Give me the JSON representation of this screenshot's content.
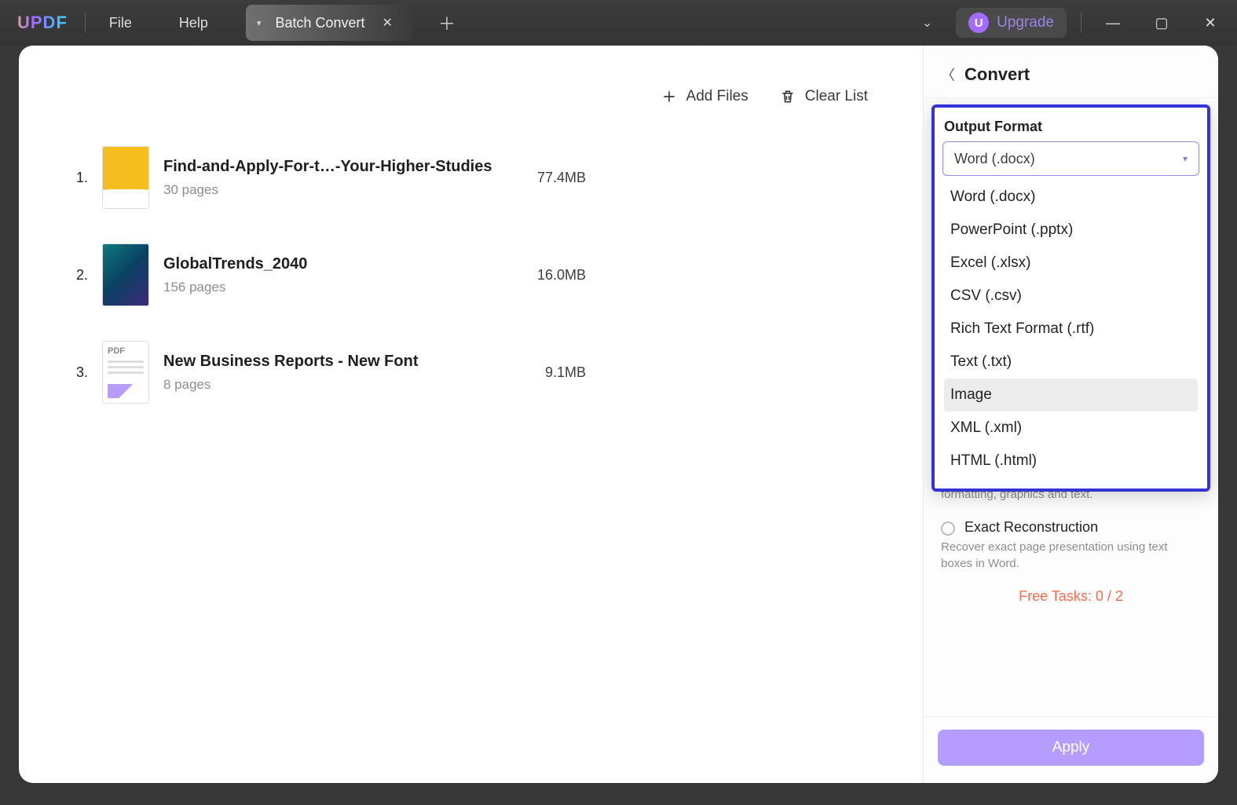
{
  "titlebar": {
    "logo": "UPDF",
    "menu_file": "File",
    "menu_help": "Help",
    "tab_label": "Batch Convert",
    "upgrade_letter": "U",
    "upgrade_label": "Upgrade"
  },
  "actions": {
    "add_files": "Add Files",
    "clear_list": "Clear List"
  },
  "files": [
    {
      "num": "1.",
      "name": "Find-and-Apply-For-t…-Your-Higher-Studies",
      "pages": "30 pages",
      "size": "77.4MB",
      "thumb": "t1"
    },
    {
      "num": "2.",
      "name": "GlobalTrends_2040",
      "pages": "156 pages",
      "size": "16.0MB",
      "thumb": "t2"
    },
    {
      "num": "3.",
      "name": "New Business Reports - New Font",
      "pages": "8 pages",
      "size": "9.1MB",
      "thumb": "t3"
    }
  ],
  "sidebar": {
    "title": "Convert",
    "output_format_label": "Output Format",
    "selected_format": "Word (.docx)",
    "format_options": [
      "Word (.docx)",
      "PowerPoint (.pptx)",
      "Excel (.xlsx)",
      "CSV (.csv)",
      "Rich Text Format (.rtf)",
      "Text (.txt)",
      "Image",
      "XML (.xml)",
      "HTML (.html)"
    ],
    "hovered_option_index": 6,
    "layout_option_desc": "Detect layout and columns but only recover formatting, graphics and text.",
    "exact_label": "Exact Reconstruction",
    "exact_desc": "Recover exact page presentation using text boxes in Word.",
    "free_tasks": "Free Tasks: 0 / 2",
    "apply_label": "Apply"
  }
}
